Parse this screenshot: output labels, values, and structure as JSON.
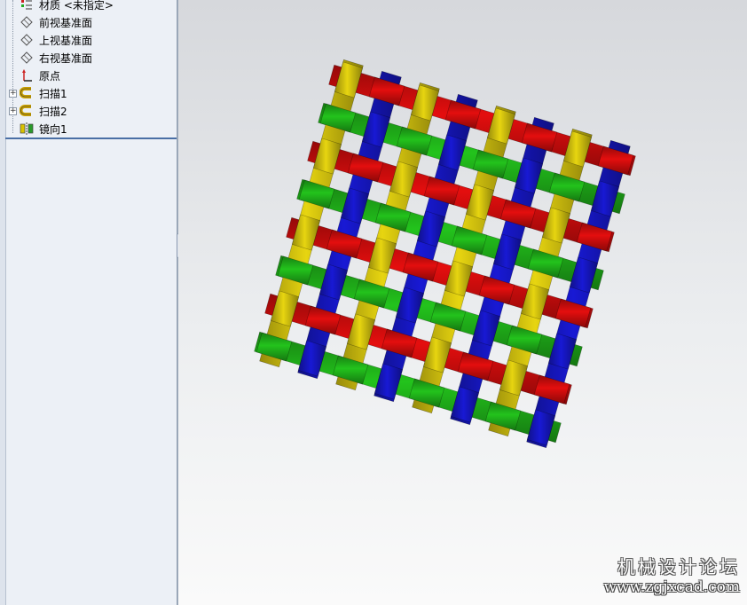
{
  "feature_tree": {
    "items": [
      {
        "label": "材质 <未指定>",
        "icon": "material-icon",
        "expandable": false
      },
      {
        "label": "前视基准面",
        "icon": "plane-icon",
        "expandable": false
      },
      {
        "label": "上视基准面",
        "icon": "plane-icon",
        "expandable": false
      },
      {
        "label": "右视基准面",
        "icon": "plane-icon",
        "expandable": false
      },
      {
        "label": "原点",
        "icon": "origin-icon",
        "expandable": false
      },
      {
        "label": "扫描1",
        "icon": "sweep-icon",
        "expandable": true
      },
      {
        "label": "扫描2",
        "icon": "sweep-icon",
        "expandable": true
      },
      {
        "label": "镜向1",
        "icon": "mirror-icon",
        "expandable": false
      }
    ]
  },
  "model": {
    "colors": {
      "yellow": "#c9b90e",
      "red": "#c60c0c",
      "green": "#1eaa18",
      "blue": "#1516b8"
    },
    "warp_color_order": [
      "yellow",
      "blue"
    ],
    "weft_color_order": [
      "red",
      "green"
    ]
  },
  "watermark": {
    "title": "机械设计论坛",
    "url": "www.zgjxcad.com"
  }
}
